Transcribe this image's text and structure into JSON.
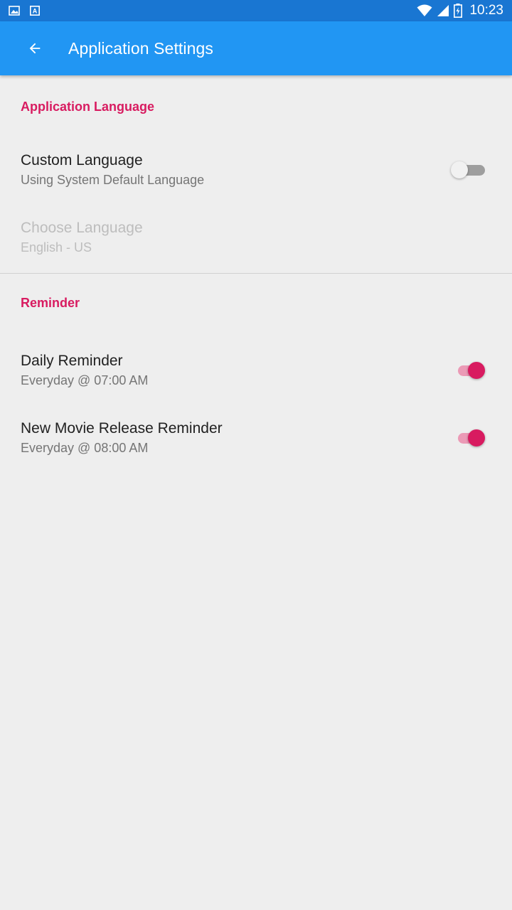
{
  "status_bar": {
    "time": "10:23",
    "left_icons": [
      "image-icon",
      "translate-icon"
    ],
    "right_icons": [
      "wifi-icon",
      "signal-icon",
      "battery-icon"
    ]
  },
  "app_bar": {
    "back_icon": "arrow-back-icon",
    "title": "Application Settings",
    "color": "#2196f3"
  },
  "sections": {
    "language": {
      "header": "Application Language",
      "custom_language": {
        "title": "Custom Language",
        "summary": "Using System Default Language",
        "enabled": false
      },
      "choose_language": {
        "title": "Choose Language",
        "summary": "English - US",
        "disabled": true
      }
    },
    "reminder": {
      "header": "Reminder",
      "daily": {
        "title": "Daily Reminder",
        "summary": "Everyday @ 07:00 AM",
        "enabled": true
      },
      "new_movie": {
        "title": "New Movie Release Reminder",
        "summary": "Everyday @ 08:00 AM",
        "enabled": true
      }
    }
  },
  "colors": {
    "accent": "#d81b60",
    "primary": "#2196f3",
    "primary_dark": "#1976d2"
  }
}
